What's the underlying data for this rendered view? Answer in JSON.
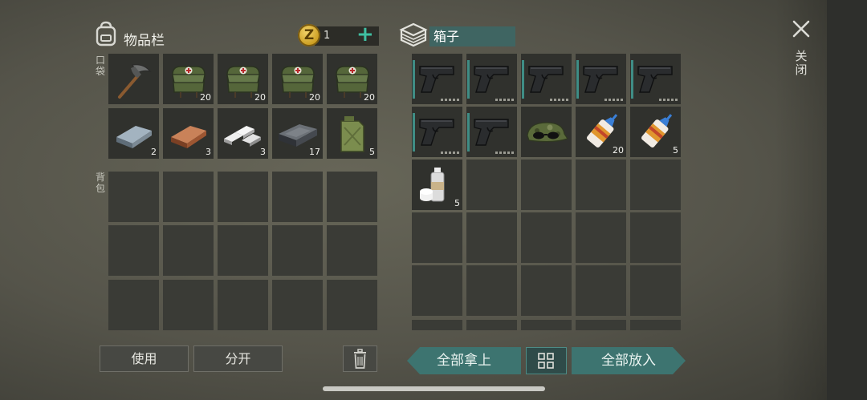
{
  "inventory": {
    "title": "物品栏",
    "icon": "backpack-icon",
    "coins": {
      "icon": "coin-icon",
      "symbol": "Z",
      "count": "1",
      "add_label": "+"
    },
    "pockets_label": "口袋",
    "backpack_label": "背包",
    "pockets": [
      {
        "item": "pickaxe",
        "qty": ""
      },
      {
        "item": "medical-bag",
        "qty": "20"
      },
      {
        "item": "medical-bag",
        "qty": "20"
      },
      {
        "item": "medical-bag",
        "qty": "20"
      },
      {
        "item": "medical-bag",
        "qty": "20"
      },
      {
        "item": "iron-ingot",
        "qty": "2"
      },
      {
        "item": "copper-ingot",
        "qty": "3"
      },
      {
        "item": "silver-ingots",
        "qty": "3"
      },
      {
        "item": "steel-ingot",
        "qty": "17"
      },
      {
        "item": "fuel-can",
        "qty": "5"
      }
    ],
    "backpack_slots": 15
  },
  "box": {
    "icon": "box-icon",
    "name": "箱子",
    "slots": [
      {
        "item": "pistol",
        "qty": ""
      },
      {
        "item": "pistol",
        "qty": ""
      },
      {
        "item": "pistol",
        "qty": ""
      },
      {
        "item": "pistol",
        "qty": ""
      },
      {
        "item": "pistol",
        "qty": ""
      },
      {
        "item": "pistol",
        "qty": ""
      },
      {
        "item": "pistol",
        "qty": ""
      },
      {
        "item": "camo-cap-sunglasses",
        "qty": ""
      },
      {
        "item": "glue-tube",
        "qty": "20"
      },
      {
        "item": "glue-tube",
        "qty": "5"
      },
      {
        "item": "spray-can",
        "qty": "5"
      }
    ],
    "total_slots": 30
  },
  "buttons": {
    "use": "使用",
    "split": "分开",
    "trash_icon": "trash-icon",
    "take_all": "全部拿上",
    "sort_icon": "grid-icon",
    "put_all": "全部放入"
  },
  "close": {
    "icon": "close-icon",
    "label": "关闭"
  },
  "colors": {
    "accent": "#3f8d85",
    "box_name_bg": "#3f6562",
    "button_teal": "#3d7470"
  }
}
